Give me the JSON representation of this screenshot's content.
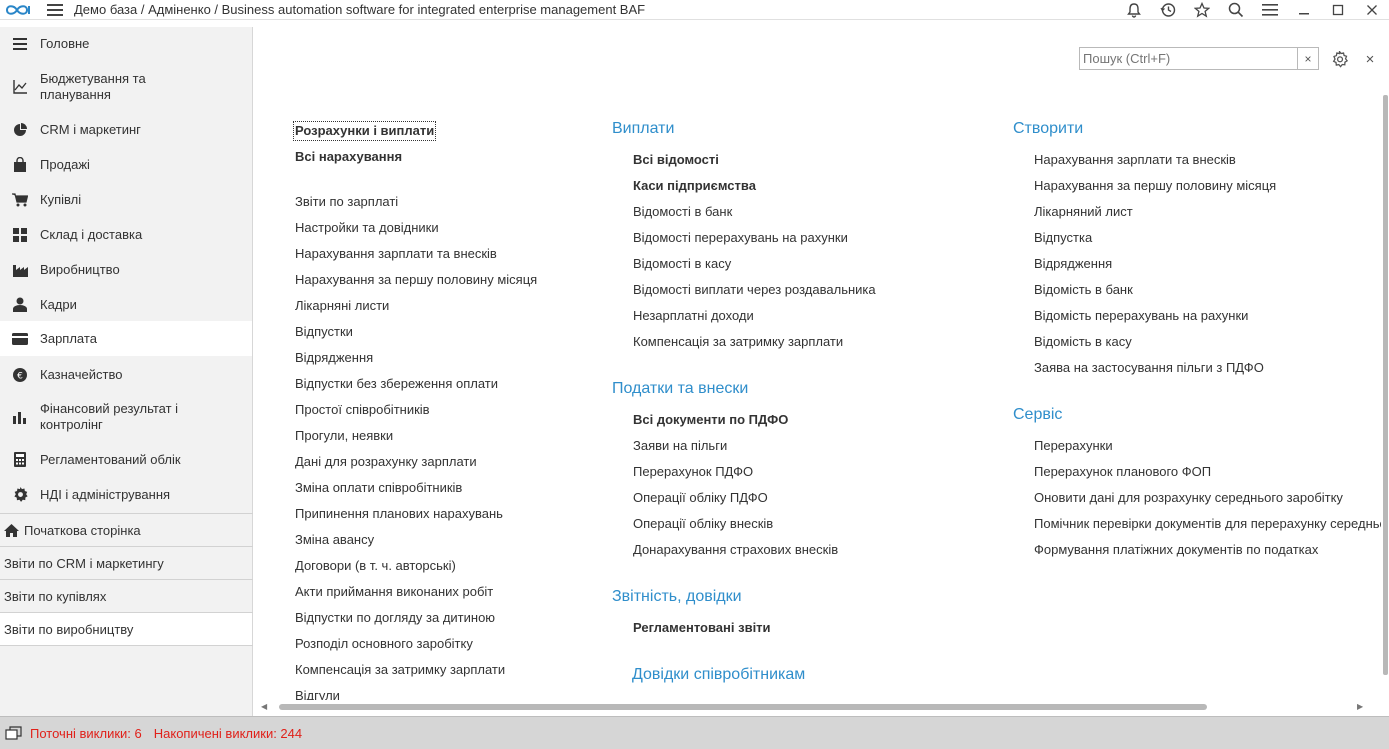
{
  "app": {
    "title": "Демо база / Адміненко / Business automation software for integrated enterprise management BAF"
  },
  "sidebar": {
    "sections": [
      {
        "label": "Головне",
        "icon": "list-icon"
      },
      {
        "label": "Бюджетування та\nпланування",
        "icon": "chart-axis-icon"
      },
      {
        "label": "CRM і маркетинг",
        "icon": "pie-chart-icon"
      },
      {
        "label": "Продажі",
        "icon": "shopping-bag-icon"
      },
      {
        "label": "Купівлі",
        "icon": "cart-icon"
      },
      {
        "label": "Склад і доставка",
        "icon": "grid-icon"
      },
      {
        "label": "Виробництво",
        "icon": "factory-icon"
      },
      {
        "label": "Кадри",
        "icon": "person-icon"
      },
      {
        "label": "Зарплата",
        "icon": "card-icon"
      },
      {
        "label": "Казначейство",
        "icon": "coin-icon"
      },
      {
        "label": "Фінансовий результат і\nконтролінг",
        "icon": "bar-chart-icon"
      },
      {
        "label": "Регламентований облік",
        "icon": "calculator-icon"
      },
      {
        "label": "НДІ і адміністрування",
        "icon": "gear-icon"
      }
    ],
    "links": [
      {
        "label": "Початкова сторінка"
      },
      {
        "label": "Звіти по CRM і маркетингу"
      },
      {
        "label": "Звіти по купівлях"
      },
      {
        "label": "Звіти по виробництву"
      }
    ]
  },
  "search": {
    "placeholder": "Пошук (Ctrl+F)",
    "clear": "×"
  },
  "close_label": "×",
  "col1": {
    "items": [
      {
        "label": "Розрахунки і виплати",
        "bold": true
      },
      {
        "label": "Всі нарахування",
        "bold": true
      },
      {
        "label": "Звіти по зарплаті"
      },
      {
        "label": "Настройки та довідники"
      },
      {
        "label": "Нарахування зарплати та внесків"
      },
      {
        "label": "Нарахування за першу половину місяця"
      },
      {
        "label": "Лікарняні листи"
      },
      {
        "label": "Відпустки"
      },
      {
        "label": "Відрядження"
      },
      {
        "label": "Відпустки без збереження оплати"
      },
      {
        "label": "Простої співробітників"
      },
      {
        "label": "Прогули, неявки"
      },
      {
        "label": "Дані для розрахунку зарплати"
      },
      {
        "label": "Зміна оплати співробітників"
      },
      {
        "label": "Припинення планових нарахувань"
      },
      {
        "label": "Зміна авансу"
      },
      {
        "label": "Договори (в т. ч. авторські)"
      },
      {
        "label": "Акти приймання виконаних робіт"
      },
      {
        "label": "Відпустки по догляду за дитиною"
      },
      {
        "label": "Розподіл основного заробітку"
      },
      {
        "label": "Компенсація за затримку зарплати"
      },
      {
        "label": "Відгули"
      }
    ]
  },
  "col2": {
    "groups": [
      {
        "title": "Виплати",
        "items": [
          {
            "label": "Всі відомості",
            "bold": true
          },
          {
            "label": "Каси підприємства",
            "bold": true
          },
          {
            "label": "Відомості в банк"
          },
          {
            "label": "Відомості перерахувань на рахунки"
          },
          {
            "label": "Відомості в касу"
          },
          {
            "label": "Відомості виплати через роздавальника"
          },
          {
            "label": "Незарплатні доходи"
          },
          {
            "label": "Компенсація за затримку зарплати"
          }
        ]
      },
      {
        "title": "Податки та внески",
        "items": [
          {
            "label": "Всі документи по ПДФО",
            "bold": true
          },
          {
            "label": "Заяви на пільги"
          },
          {
            "label": "Перерахунок ПДФО"
          },
          {
            "label": "Операції обліку ПДФО"
          },
          {
            "label": "Операції обліку внесків"
          },
          {
            "label": "Донарахування страхових внесків"
          }
        ]
      },
      {
        "title": "Звітність, довідки",
        "items": [
          {
            "label": "Регламентовані звіти",
            "bold": true
          }
        ]
      },
      {
        "title": "Довідки співробітникам",
        "items": []
      }
    ]
  },
  "col3": {
    "groups": [
      {
        "title": "Створити",
        "items": [
          {
            "label": "Нарахування зарплати та внесків"
          },
          {
            "label": "Нарахування за першу половину місяця"
          },
          {
            "label": "Лікарняний лист"
          },
          {
            "label": "Відпустка"
          },
          {
            "label": "Відрядження"
          },
          {
            "label": "Відомість в банк"
          },
          {
            "label": "Відомість перерахувань на рахунки"
          },
          {
            "label": "Відомість в касу"
          },
          {
            "label": "Заява на застосування пільги з ПДФО"
          }
        ]
      },
      {
        "title": "Сервіс",
        "items": [
          {
            "label": "Перерахунки"
          },
          {
            "label": "Перерахунок планового ФОП"
          },
          {
            "label": "Оновити дані для розрахунку середнього заробітку"
          },
          {
            "label": "Помічник перевірки документів для перерахунку середньо"
          },
          {
            "label": "Формування платіжних документів по податках"
          }
        ]
      }
    ]
  },
  "status": {
    "current_calls": "Поточні виклики: 6",
    "accumulated_calls": "Накопичені виклики: 244"
  },
  "colors": {
    "accent": "#2f8ecb",
    "status_red": "#e0211a",
    "sidebar_bg": "#f2f2f2"
  }
}
